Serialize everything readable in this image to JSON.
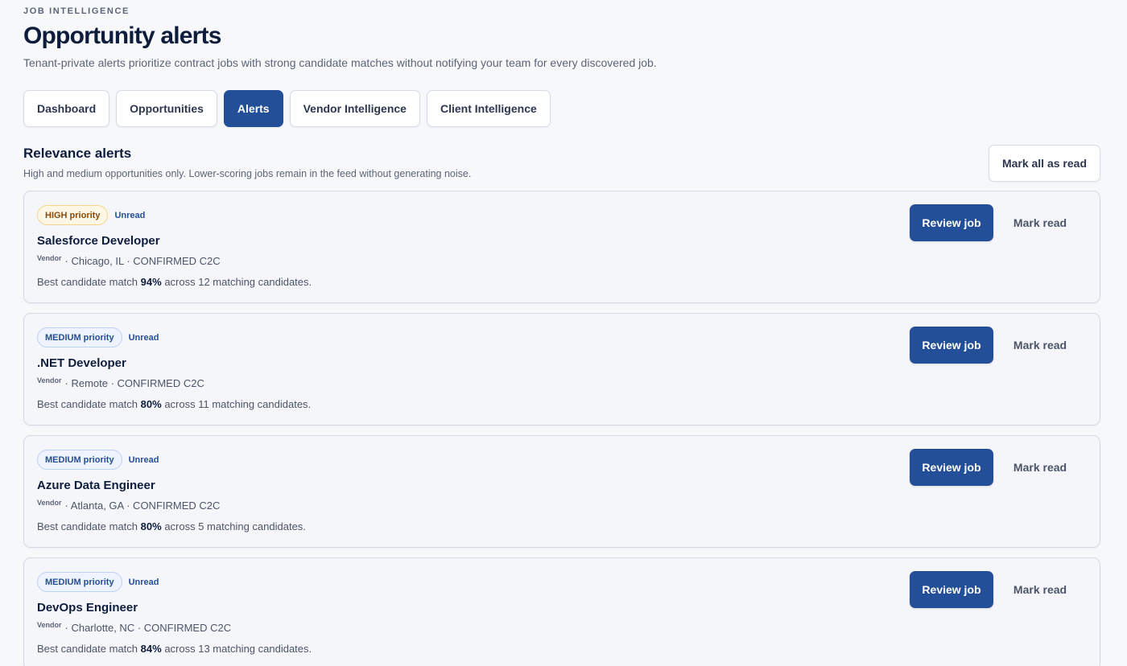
{
  "header": {
    "eyebrow": "JOB INTELLIGENCE",
    "title": "Opportunity alerts",
    "subtitle": "Tenant-private alerts prioritize contract jobs with strong candidate matches without notifying your team for every discovered job."
  },
  "tabs": [
    {
      "label": "Dashboard",
      "active": false
    },
    {
      "label": "Opportunities",
      "active": false
    },
    {
      "label": "Alerts",
      "active": true
    },
    {
      "label": "Vendor Intelligence",
      "active": false
    },
    {
      "label": "Client Intelligence",
      "active": false
    }
  ],
  "section": {
    "title": "Relevance alerts",
    "description": "High and medium opportunities only. Lower-scoring jobs remain in the feed without generating noise.",
    "mark_all_label": "Mark all as read"
  },
  "alerts": [
    {
      "priority": "HIGH priority",
      "priority_level": "high",
      "status": "Unread",
      "title": "Salesforce Developer",
      "vendor_label": "Vendor",
      "meta": "· Chicago, IL · CONFIRMED C2C",
      "match_prefix": "Best candidate match",
      "match_percent": "94%",
      "match_suffix": "across 12 matching candidates.",
      "review_label": "Review job",
      "mark_read_label": "Mark read"
    },
    {
      "priority": "MEDIUM priority",
      "priority_level": "medium",
      "status": "Unread",
      "title": ".NET Developer",
      "vendor_label": "Vendor",
      "meta": "· Remote · CONFIRMED C2C",
      "match_prefix": "Best candidate match",
      "match_percent": "80%",
      "match_suffix": "across 11 matching candidates.",
      "review_label": "Review job",
      "mark_read_label": "Mark read"
    },
    {
      "priority": "MEDIUM priority",
      "priority_level": "medium",
      "status": "Unread",
      "title": "Azure Data Engineer",
      "vendor_label": "Vendor",
      "meta": "· Atlanta, GA · CONFIRMED C2C",
      "match_prefix": "Best candidate match",
      "match_percent": "80%",
      "match_suffix": "across 5 matching candidates.",
      "review_label": "Review job",
      "mark_read_label": "Mark read"
    },
    {
      "priority": "MEDIUM priority",
      "priority_level": "medium",
      "status": "Unread",
      "title": "DevOps Engineer",
      "vendor_label": "Vendor",
      "meta": "· Charlotte, NC · CONFIRMED C2C",
      "match_prefix": "Best candidate match",
      "match_percent": "84%",
      "match_suffix": "across 13 matching candidates.",
      "review_label": "Review job",
      "mark_read_label": "Mark read"
    }
  ],
  "colors": {
    "accent": "#234f99",
    "background": "#f7f8fa",
    "high_badge_bg": "#fff7e6",
    "high_badge_text": "#8a4a09",
    "medium_badge_bg": "#eef3fd"
  }
}
